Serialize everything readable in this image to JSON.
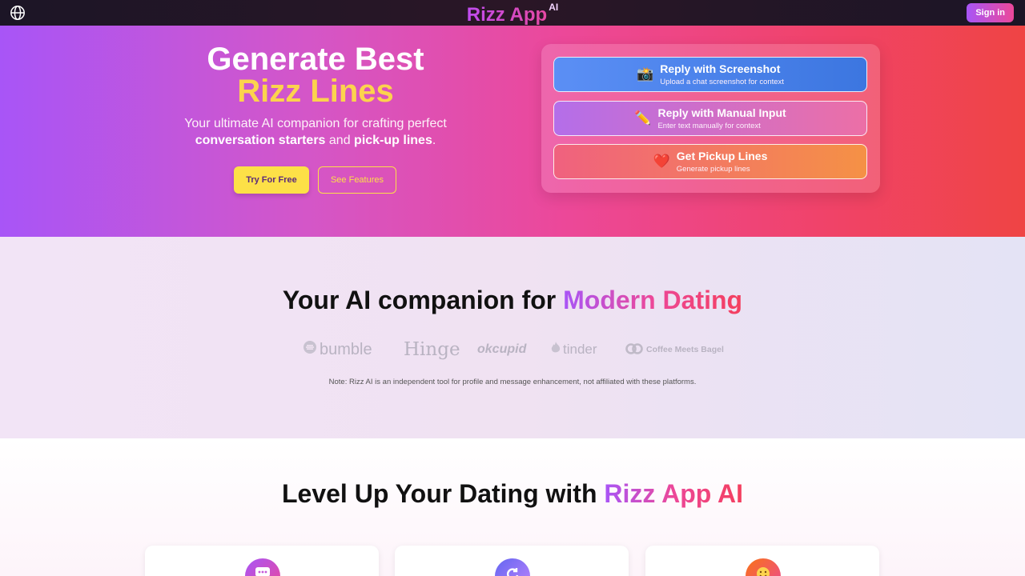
{
  "navbar": {
    "brand": "Rizz App",
    "brand_sup": "AI",
    "signin_label": "Sign in",
    "language_icon": "globe-icon"
  },
  "hero": {
    "title_line1": "Generate Best",
    "title_line2": "Rizz Lines",
    "subtitle_start": "Your ultimate AI companion for crafting perfect",
    "subtitle_bold1": "conversation starters",
    "subtitle_and": "and",
    "subtitle_bold2": "pick-up lines",
    "subtitle_end": ".",
    "try_label": "Try For Free",
    "features_label": "See Features"
  },
  "actions": [
    {
      "icon": "📸",
      "icon_name": "camera-icon",
      "title": "Reply with Screenshot",
      "desc": "Upload a chat screenshot for context"
    },
    {
      "icon": "✏️",
      "icon_name": "pencil-icon",
      "title": "Reply with Manual Input",
      "desc": "Enter text manually for context"
    },
    {
      "icon": "❤️",
      "icon_name": "heart-icon",
      "title": "Get Pickup Lines",
      "desc": "Generate pickup lines"
    }
  ],
  "companion": {
    "heading_plain": "Your AI companion for",
    "heading_accent": "Modern Dating",
    "logos": [
      "bumble",
      "Hinge",
      "okcupid",
      "tinder",
      "Coffee Meets Bagel"
    ],
    "note": "Note: Rizz AI is an independent tool for profile and message enhancement, not affiliated with these platforms."
  },
  "levelup": {
    "heading_plain": "Level Up Your Dating with",
    "heading_accent": "Rizz App AI"
  },
  "colors": {
    "hero_gradient": [
      "#a855f7",
      "#ec4899",
      "#ef4444"
    ],
    "accent_yellow": "#fde047",
    "brand_purple": "#a855f7",
    "brand_pink": "#ec4899"
  }
}
